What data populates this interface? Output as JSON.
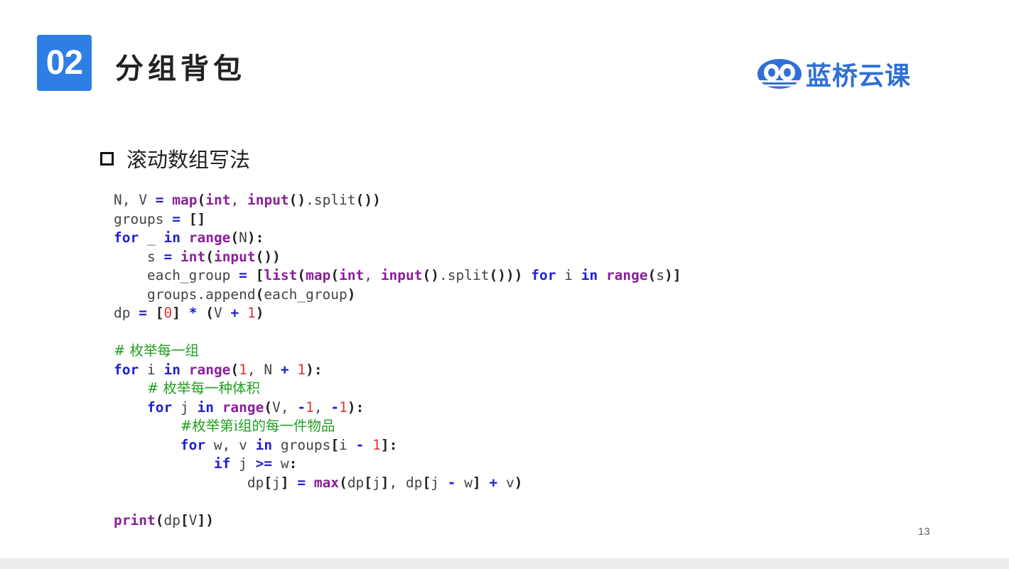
{
  "slide": {
    "section_number": "02",
    "section_title": "分组背包",
    "logo_text": "蓝桥云课",
    "bullet": "滚动数组写法",
    "page_number": "13",
    "colors": {
      "badge": "#2f7ee6",
      "keyword": "#1f1fd0",
      "builtin": "#8b1f9b",
      "number": "#e0352c",
      "comment": "#22a022"
    }
  },
  "code": {
    "language": "python",
    "lines": [
      "N, V = map(int, input().split())",
      "groups = []",
      "for _ in range(N):",
      "    s = int(input())",
      "    each_group = [list(map(int, input().split())) for i in range(s)]",
      "    groups.append(each_group)",
      "dp = [0] * (V + 1)",
      "",
      "# 枚举每一组",
      "for i in range(1, N + 1):",
      "    # 枚举每一种体积",
      "    for j in range(V, -1, -1):",
      "        #枚举第i组的每一件物品",
      "        for w, v in groups[i - 1]:",
      "            if j >= w:",
      "                dp[j] = max(dp[j], dp[j - w] + v)",
      "",
      "print(dp[V])"
    ]
  }
}
